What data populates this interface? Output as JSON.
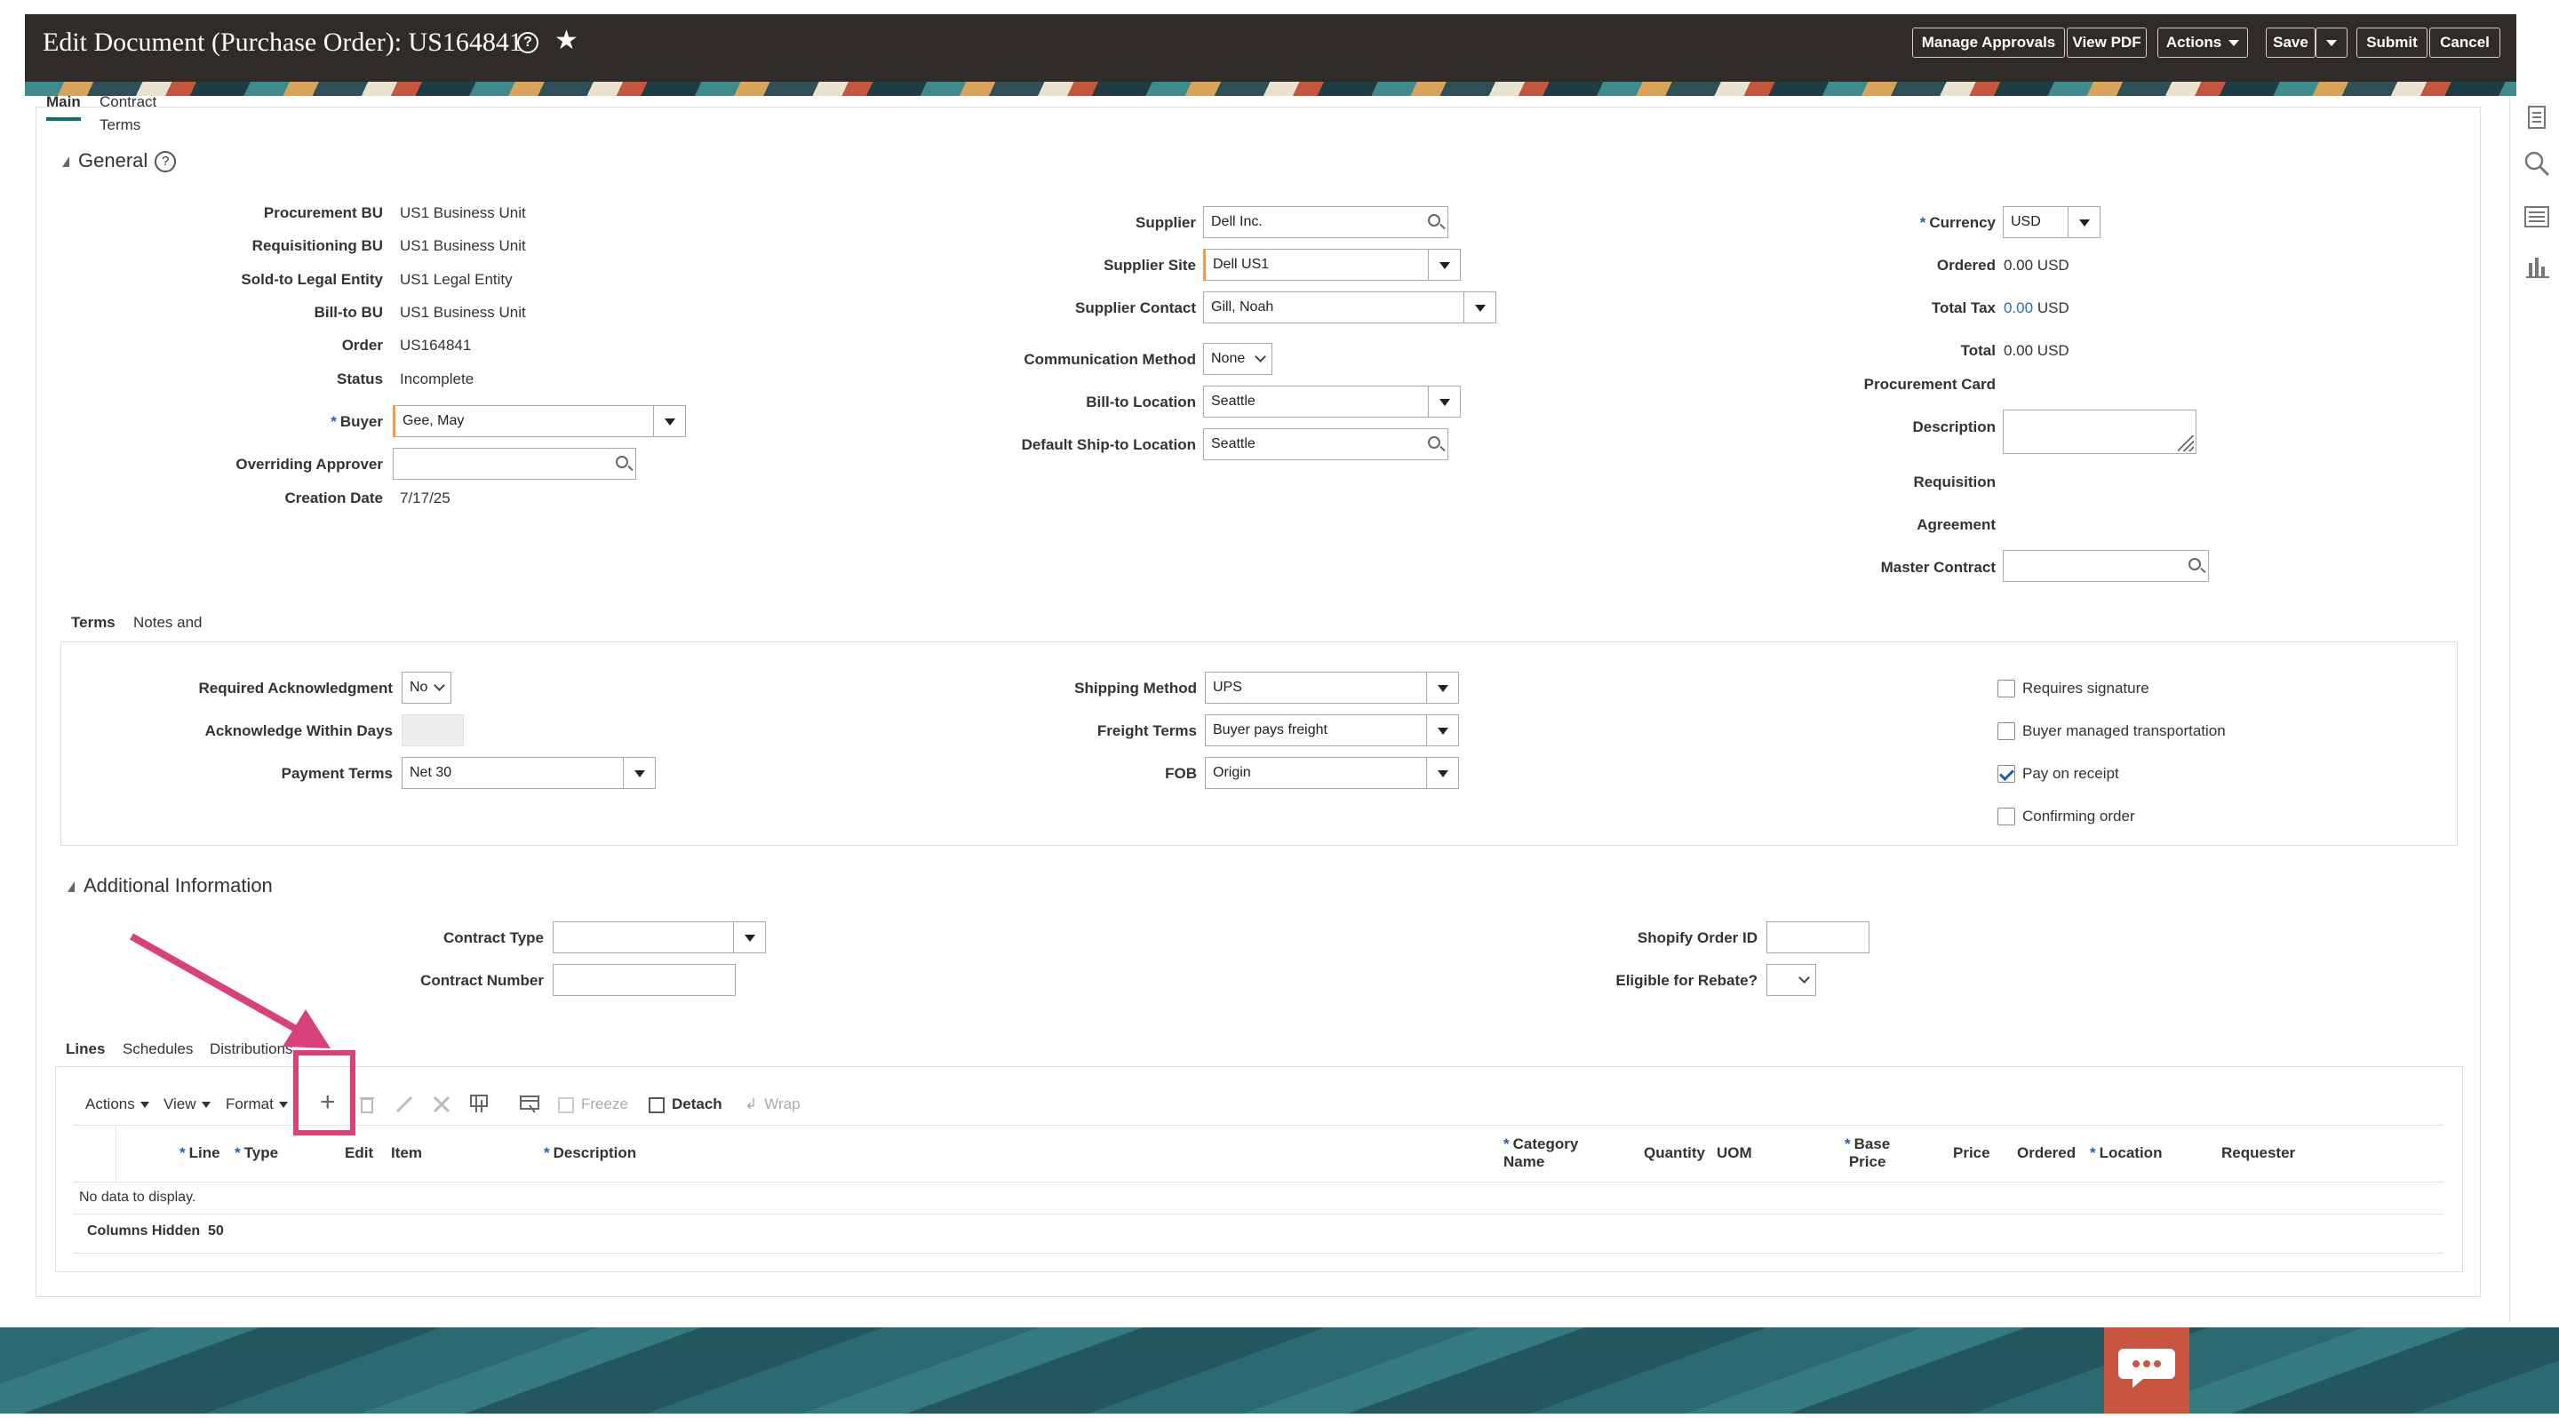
{
  "header": {
    "title": "Edit Document (Purchase Order): US164841",
    "buttons": {
      "manage_approvals": "Manage Approvals",
      "view_pdf": "View PDF",
      "actions": "Actions",
      "save": "Save",
      "submit": "Submit",
      "cancel": "Cancel"
    }
  },
  "subtabs": {
    "main": "Main",
    "contract_terms": "Contract Terms"
  },
  "general": {
    "title": "General",
    "procurement_bu_label": "Procurement BU",
    "procurement_bu": "US1 Business Unit",
    "requisitioning_bu_label": "Requisitioning BU",
    "requisitioning_bu": "US1 Business Unit",
    "sold_to_label": "Sold-to Legal Entity",
    "sold_to": "US1 Legal Entity",
    "bill_to_bu_label": "Bill-to BU",
    "bill_to_bu": "US1 Business Unit",
    "order_label": "Order",
    "order": "US164841",
    "status_label": "Status",
    "status": "Incomplete",
    "buyer_label": "Buyer",
    "buyer": "Gee, May",
    "overriding_approver_label": "Overriding Approver",
    "overriding_approver": "",
    "creation_date_label": "Creation Date",
    "creation_date": "7/17/25",
    "supplier_label": "Supplier",
    "supplier": "Dell Inc.",
    "supplier_site_label": "Supplier Site",
    "supplier_site": "Dell US1",
    "supplier_contact_label": "Supplier Contact",
    "supplier_contact": "Gill, Noah",
    "comm_method_label": "Communication Method",
    "comm_method": "None",
    "bill_to_location_label": "Bill-to Location",
    "bill_to_location": "Seattle",
    "ship_to_label": "Default Ship-to Location",
    "ship_to": "Seattle",
    "currency_label": "Currency",
    "currency": "USD",
    "ordered_label": "Ordered",
    "ordered": "0.00 USD",
    "total_tax_label": "Total Tax",
    "total_tax_value": "0.00",
    "total_tax_unit": "USD",
    "total_label": "Total",
    "total": "0.00 USD",
    "procurement_card_label": "Procurement Card",
    "description_label": "Description",
    "requisition_label": "Requisition",
    "agreement_label": "Agreement",
    "master_contract_label": "Master Contract"
  },
  "terms_tabs": {
    "terms": "Terms",
    "notes": "Notes and Attachments"
  },
  "terms": {
    "req_ack_label": "Required Acknowledgment",
    "req_ack": "No",
    "ack_days_label": "Acknowledge Within Days",
    "payment_terms_label": "Payment Terms",
    "payment_terms": "Net 30",
    "shipping_method_label": "Shipping Method",
    "shipping_method": "UPS",
    "freight_terms_label": "Freight Terms",
    "freight_terms": "Buyer pays freight",
    "fob_label": "FOB",
    "fob": "Origin",
    "requires_signature": "Requires signature",
    "buyer_managed": "Buyer managed transportation",
    "pay_on_receipt": "Pay on receipt",
    "confirming_order": "Confirming order"
  },
  "additional": {
    "title": "Additional Information",
    "contract_type_label": "Contract Type",
    "contract_number_label": "Contract Number",
    "shopify_label": "Shopify Order ID",
    "rebate_label": "Eligible for Rebate?"
  },
  "lines_tabs": {
    "lines": "Lines",
    "schedules": "Schedules",
    "distributions": "Distributions"
  },
  "toolbar": {
    "actions": "Actions",
    "view": "View",
    "format": "Format",
    "freeze": "Freeze",
    "detach": "Detach",
    "wrap": "Wrap"
  },
  "table": {
    "columns": {
      "line": "Line",
      "type": "Type",
      "edit": "Edit",
      "item": "Item",
      "description": "Description",
      "category1": "Category",
      "category2": "Name",
      "quantity": "Quantity",
      "uom": "UOM",
      "base1": "Base",
      "base2": "Price",
      "price": "Price",
      "ordered": "Ordered",
      "location": "Location",
      "requester": "Requester"
    },
    "empty": "No data to display.",
    "columns_hidden_label": "Columns Hidden",
    "columns_hidden": "50"
  },
  "colors": {
    "header_bg": "#2e2b28",
    "accent": "#0e6e68",
    "highlight": "#d9417a",
    "link": "#2a6cb0"
  }
}
